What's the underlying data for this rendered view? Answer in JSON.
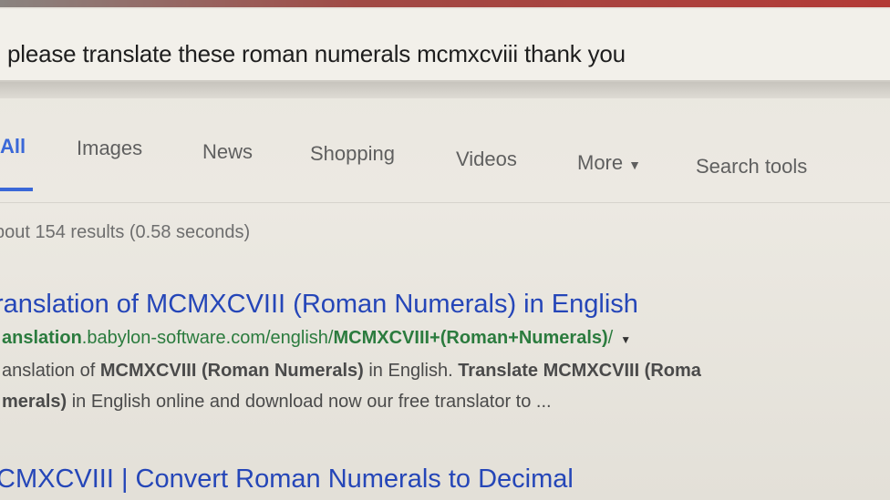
{
  "search": {
    "query": "please translate these roman numerals mcmxcviii thank you"
  },
  "tabs": [
    {
      "label": "All"
    },
    {
      "label": "Images"
    },
    {
      "label": "News"
    },
    {
      "label": "Shopping"
    },
    {
      "label": "Videos"
    },
    {
      "label": "More"
    },
    {
      "label": "Search tools"
    }
  ],
  "stats": "bout 154 results (0.58 seconds)",
  "results": [
    {
      "title": "ranslation of MCMXCVIII (Roman Numerals) in English",
      "url_prefix": "anslation",
      "url_domain": ".babylon-software.com/english/",
      "url_bold": "MCMXCVIII+(Roman+Numerals)",
      "url_suffix": "/",
      "snippet_line1_a": "anslation of ",
      "snippet_line1_b": "MCMXCVIII (Roman Numerals)",
      "snippet_line1_c": " in English. ",
      "snippet_line1_d": "Translate MCMXCVIII (Roma",
      "snippet_line2_a": "merals)",
      "snippet_line2_b": " in English online and download now our free translator to ..."
    },
    {
      "title": "CMXCVIII | Convert Roman Numerals to Decimal"
    }
  ],
  "icons": {
    "more_caret": "▼",
    "url_caret": "▼"
  }
}
